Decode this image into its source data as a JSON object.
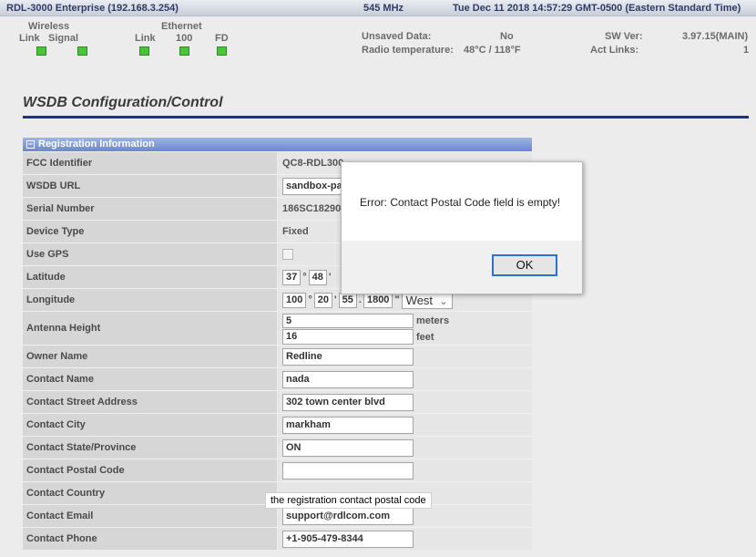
{
  "header": {
    "device": "RDL-3000 Enterprise (192.168.3.254)",
    "frequency": "545 MHz",
    "datetime": "Tue Dec 11 2018 14:57:29 GMT-0500 (Eastern Standard Time)"
  },
  "status": {
    "wireless_title": "Wireless",
    "ethernet_title": "Ethernet",
    "wireless_link": "Link",
    "wireless_signal": "Signal",
    "eth_link": "Link",
    "eth_100": "100",
    "eth_fd": "FD",
    "unsaved_label": "Unsaved Data:",
    "unsaved_value": "No",
    "radio_temp_label": "Radio temperature:",
    "radio_temp_value": "48°C / 118°F",
    "sw_ver_label": "SW Ver:",
    "sw_ver_value": "3.97.15(MAIN)",
    "act_links_label": "Act Links:",
    "act_links_value": "1",
    "led_color": "#49c43b"
  },
  "page_title": "WSDB Configuration/Control",
  "section": {
    "title": "Registration Information"
  },
  "fields": {
    "fcc_identifier": {
      "label": "FCC Identifier",
      "value": "QC8-RDL300"
    },
    "wsdb_url": {
      "label": "WSDB URL",
      "value": "sandbox-pa"
    },
    "serial_number": {
      "label": "Serial Number",
      "value": "186SC18290"
    },
    "device_type": {
      "label": "Device Type",
      "value": "Fixed"
    },
    "use_gps": {
      "label": "Use GPS"
    },
    "latitude": {
      "label": "Latitude",
      "deg": "37",
      "min": "48",
      "deg_sym": "°",
      "min_sym": "'"
    },
    "longitude": {
      "label": "Longitude",
      "deg": "100",
      "min": "20",
      "sec": "55",
      "frac": "1800",
      "hemisphere": "West",
      "deg_sym": "°",
      "min_sym": "'",
      "dot": ".",
      "sec_sym": "\""
    },
    "antenna_height": {
      "label": "Antenna Height",
      "meters": "5",
      "meters_unit": "meters",
      "feet": "16",
      "feet_unit": "feet"
    },
    "owner_name": {
      "label": "Owner Name",
      "value": "Redline"
    },
    "contact_name": {
      "label": "Contact Name",
      "value": "nada"
    },
    "contact_street": {
      "label": "Contact Street Address",
      "value": "302 town center blvd"
    },
    "contact_city": {
      "label": "Contact City",
      "value": "markham"
    },
    "contact_state": {
      "label": "Contact State/Province",
      "value": "ON"
    },
    "contact_postal": {
      "label": "Contact Postal Code",
      "value": ""
    },
    "contact_country": {
      "label": "Contact Country"
    },
    "contact_email": {
      "label": "Contact Email",
      "value": "support@rdlcom.com"
    },
    "contact_phone": {
      "label": "Contact Phone",
      "value": "+1-905-479-8344"
    }
  },
  "tooltip": "the registration contact postal code",
  "dialog": {
    "message": "Error: Contact Postal Code field is empty!",
    "ok_label": "OK"
  }
}
